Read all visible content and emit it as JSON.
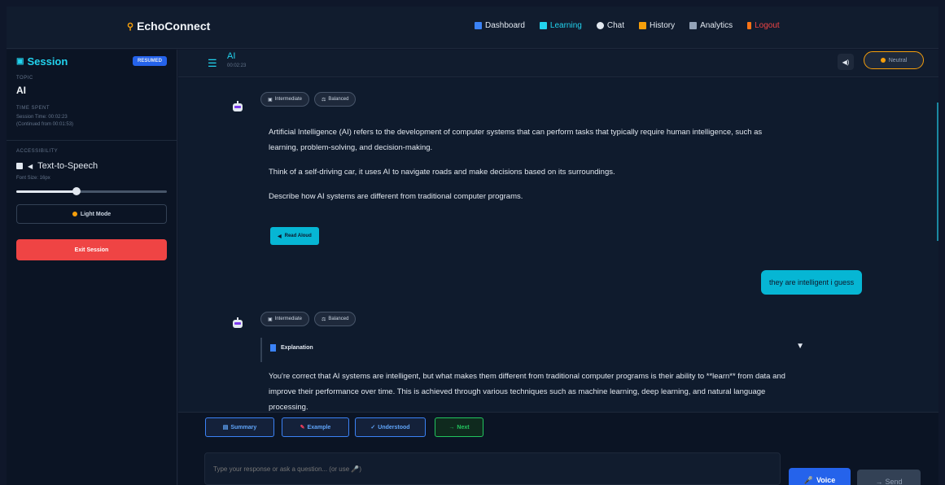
{
  "app": {
    "brand": "EchoConnect"
  },
  "nav": {
    "items": [
      {
        "label": "Dashboard",
        "icon": "dashboard-icon",
        "color": "#3b82f6"
      },
      {
        "label": "Learning",
        "icon": "learning-icon",
        "color": "#22d3ee",
        "active": true
      },
      {
        "label": "Chat",
        "icon": "chat-icon",
        "color": "#e2e8f0"
      },
      {
        "label": "History",
        "icon": "history-icon",
        "color": "#f59e0b"
      },
      {
        "label": "Analytics",
        "icon": "analytics-icon",
        "color": "#94a3b8"
      },
      {
        "label": "Logout",
        "icon": "logout-icon",
        "color": "#ef4444"
      }
    ]
  },
  "sidebar": {
    "title": "Session",
    "badge": "RESUMED",
    "topic_label": "TOPIC",
    "topic": "AI",
    "time_label": "TIME SPENT",
    "session_time": "Session Time: 00:02:23",
    "continued": "(Continued from 00:01:53)",
    "accessibility_label": "ACCESSIBILITY",
    "tts_label": "Text-to-Speech",
    "tts_checked": true,
    "font_size_label": "Font Size: 16px",
    "font_slider_fraction": 0.4,
    "light_mode": "Light Mode",
    "exit": "Exit Session"
  },
  "chat_header": {
    "title": "AI",
    "time": "00:02:23",
    "mood": "Neutral"
  },
  "messages": [
    {
      "role": "bot",
      "chips": [
        "Intermediate",
        "Balanced"
      ],
      "paragraphs": [
        "Artificial Intelligence (AI) refers to the development of computer systems that can perform tasks that typically require human intelligence, such as learning, problem-solving, and decision-making.",
        "Think of a self-driving car, it uses AI to navigate roads and make decisions based on its surroundings.",
        "Describe how AI systems are different from traditional computer programs."
      ],
      "action": "Read Aloud"
    },
    {
      "role": "user",
      "text": "they are intelligent i guess"
    },
    {
      "role": "bot",
      "chips": [
        "Intermediate",
        "Balanced"
      ],
      "section": "Explanation",
      "paragraphs": [
        "You're correct that AI systems are intelligent, but what makes them different from traditional computer programs is their ability to **learn** from data and improve their performance over time. This is achieved through various techniques such as machine learning, deep learning, and natural language processing."
      ]
    }
  ],
  "actions": {
    "summary": "Summary",
    "example": "Example",
    "understood": "Understood",
    "next": "Next"
  },
  "composer": {
    "placeholder": "Type your response or ask a question... (or use 🎤)",
    "voice": "Voice",
    "send": "Send"
  }
}
